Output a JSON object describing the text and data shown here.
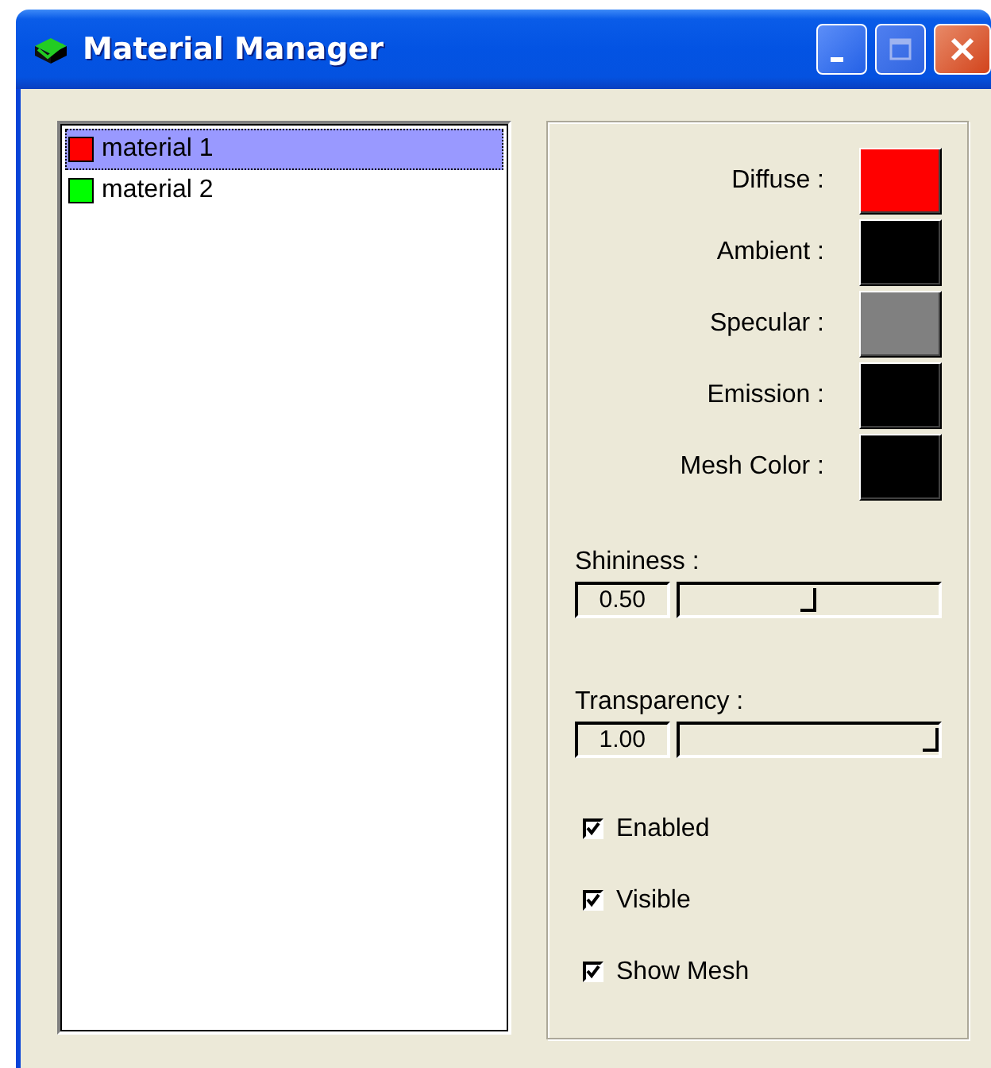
{
  "window": {
    "title": "Material Manager"
  },
  "materials": [
    {
      "name": "material 1",
      "color": "#ff0000",
      "selected": true
    },
    {
      "name": "material 2",
      "color": "#00ff00",
      "selected": false
    }
  ],
  "colors": [
    {
      "label": "Diffuse :",
      "color": "#ff0000"
    },
    {
      "label": "Ambient :",
      "color": "#000000"
    },
    {
      "label": "Specular :",
      "color": "#808080"
    },
    {
      "label": "Emission :",
      "color": "#000000"
    },
    {
      "label": "Mesh Color :",
      "color": "#000000"
    }
  ],
  "sliders": [
    {
      "label": "Shininess :",
      "value": "0.50",
      "level": 0.5
    },
    {
      "label": "Transparency :",
      "value": "1.00",
      "level": 1.0
    }
  ],
  "checkboxes": [
    {
      "label": "Enabled",
      "checked": true
    },
    {
      "label": "Visible",
      "checked": true
    },
    {
      "label": "Show Mesh",
      "checked": true
    }
  ]
}
